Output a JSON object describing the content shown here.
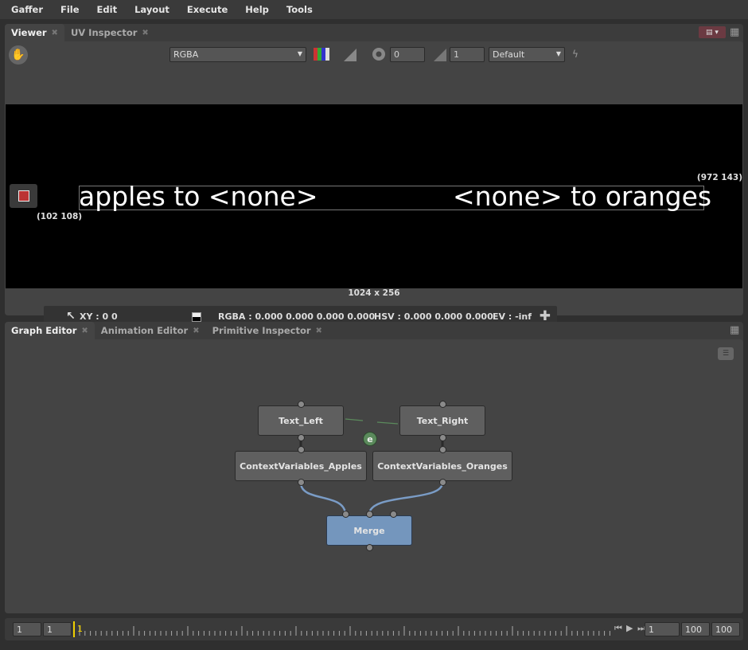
{
  "menubar": {
    "items": [
      "Gaffer",
      "File",
      "Edit",
      "Layout",
      "Execute",
      "Help",
      "Tools"
    ]
  },
  "viewer": {
    "tabs": [
      {
        "label": "Viewer"
      },
      {
        "label": "UV Inspector"
      }
    ],
    "toolbar": {
      "channel_combo": "RGBA",
      "exposure_value": "0",
      "gamma_value": "1",
      "display_transform": "Default"
    },
    "image": {
      "text_left": "apples to <none>",
      "text_right": "<none> to oranges",
      "data_window_max": "(972 143)",
      "data_window_min": "(102 108)",
      "resolution": "1024 x 256"
    },
    "pixel_info": {
      "xy": "XY : 0 0",
      "rgba": "RGBA : 0.000 0.000 0.000 0.000",
      "hsv": "HSV : 0.000 0.000 0.000",
      "ev": "EV : -inf"
    }
  },
  "graph_editor": {
    "tabs": [
      {
        "label": "Graph Editor"
      },
      {
        "label": "Animation Editor"
      },
      {
        "label": "Primitive Inspector"
      }
    ],
    "nodes": {
      "text_left": "Text_Left",
      "text_right": "Text_Right",
      "cv_apples": "ContextVariables_Apples",
      "cv_oranges": "ContextVariables_Oranges",
      "merge": "Merge",
      "expression": "e"
    }
  },
  "timeline": {
    "start_outer": "1",
    "start_inner": "1",
    "current_frame": "1",
    "frame_field": "1",
    "end_inner": "100",
    "end_outer": "100"
  },
  "colors": {
    "merge_node": "#7496bd",
    "expression_node": "#5b8a5c",
    "current_frame": "#f0d000"
  }
}
